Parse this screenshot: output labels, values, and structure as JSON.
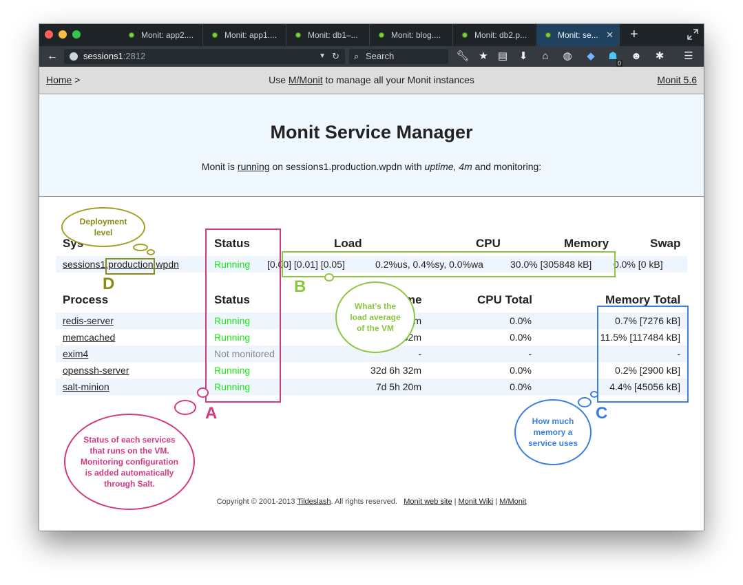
{
  "browser": {
    "tabs": [
      {
        "label": "Monit: app2...."
      },
      {
        "label": "Monit: app1...."
      },
      {
        "label": "Monit: db1–..."
      },
      {
        "label": "Monit: blog...."
      },
      {
        "label": "Monit: db2.p..."
      },
      {
        "label": "Monit: se..."
      }
    ],
    "new_tab_label": "+",
    "url_host": "sessions1",
    "url_port": ":2812",
    "search_placeholder": "Search",
    "notification_count": "0"
  },
  "monit": {
    "home_link": "Home",
    "breadcrumb_sep": ">",
    "mm_prefix": "Use ",
    "mm_link": "M/Monit",
    "mm_suffix": " to manage all your Monit instances",
    "version_link": "Monit 5.6",
    "title": "Monit Service Manager",
    "sub_prefix": "Monit is ",
    "sub_running": "running",
    "sub_host": " on sessions1.production.wpdn with ",
    "sub_uptime": "uptime, 4m",
    "sub_suffix": "  and monitoring:"
  },
  "system_table": {
    "headers": {
      "system": "Sys",
      "status": "Status",
      "load": "Load",
      "cpu": "CPU",
      "memory": "Memory",
      "swap": "Swap"
    },
    "row": {
      "name_pre": "sessions1",
      "name_mid": ".production",
      "name_post": ".wpdn",
      "status": "Running",
      "load": "[0.00] [0.01] [0.05]",
      "cpu": "0.2%us, 0.4%sy, 0.0%wa",
      "memory": "30.0% [305848 kB]",
      "swap": "0.0% [0 kB]"
    }
  },
  "process_table": {
    "headers": {
      "process": "Process",
      "status": "Status",
      "uptime": "me",
      "cpu_total": "CPU Total",
      "memory_total": "Memory Total"
    },
    "rows": [
      {
        "name": "redis-server",
        "status": "Running",
        "uptime": "m",
        "cpu": "0.0%",
        "memory": "0.7% [7276 kB]"
      },
      {
        "name": "memcached",
        "status": "Running",
        "uptime": "32m",
        "cpu": "0.0%",
        "memory": "11.5% [117484 kB]"
      },
      {
        "name": "exim4",
        "status": "Not monitored",
        "uptime": "-",
        "cpu": "-",
        "memory": "-"
      },
      {
        "name": "openssh-server",
        "status": "Running",
        "uptime": "32d 6h 32m",
        "cpu": "0.0%",
        "memory": "0.2% [2900 kB]"
      },
      {
        "name": "salt-minion",
        "status": "Running",
        "uptime": "7d 5h 20m",
        "cpu": "0.0%",
        "memory": "4.4% [45056 kB]"
      }
    ]
  },
  "footer": {
    "copyright": "Copyright © 2001-2013 ",
    "company": "Tildeslash",
    "rights": ". All rights reserved.",
    "site_link": "Monit web site",
    "sep": "|",
    "wiki_link": "Monit Wiki",
    "mmonit_link": "M/Monit"
  },
  "annotations": {
    "a": {
      "letter": "A",
      "text": "Status of each services that runs on the VM. Monitoring configuration is added automatically through Salt.",
      "color": "#d2397e"
    },
    "b": {
      "letter": "B",
      "text": "What's the load average of the VM",
      "color": "#8cc63f"
    },
    "c": {
      "letter": "C",
      "text": "How much memory a service uses",
      "color": "#3d7fe0"
    },
    "d": {
      "letter": "D",
      "text": "Deployment level",
      "color": "#8a8a1a"
    }
  },
  "colors": {
    "running": "#19e619",
    "not_monitored": "#888888",
    "hero_bg": "#eff7ff",
    "header_bg": "#dddddd"
  }
}
